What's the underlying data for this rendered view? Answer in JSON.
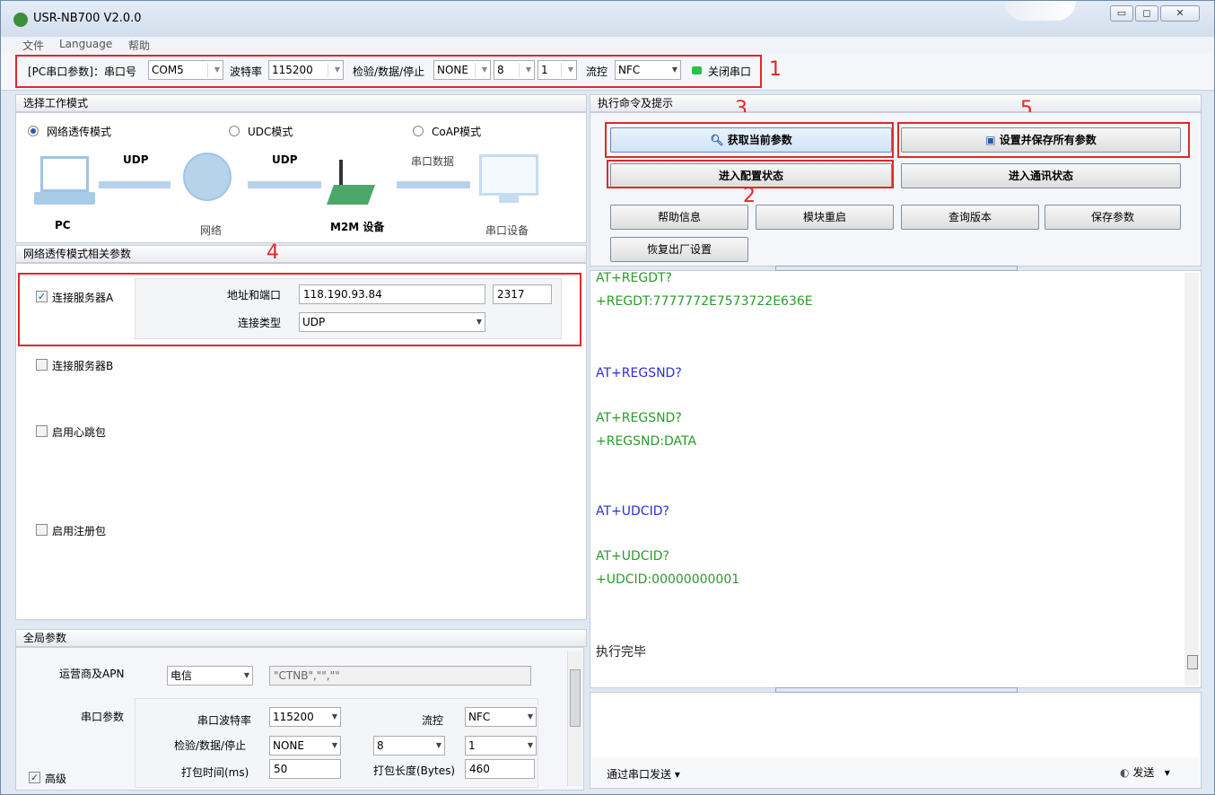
{
  "window": {
    "title": "USR-NB700 V2.0.0",
    "min": "▭",
    "max": "◻",
    "close": "✕"
  },
  "menu": [
    "文件",
    "Language",
    "帮助"
  ],
  "toolbar": {
    "pc_label": "[PC串口参数]：串口号",
    "port": "COM5",
    "baud_label": "波特率",
    "baud": "115200",
    "parity_label": "检验/数据/停止",
    "parity": "NONE",
    "databits": "8",
    "stopbits": "1",
    "flow_label": "流控",
    "flow": "NFC",
    "close_port": "关闭串口",
    "status_color": "#27c24c"
  },
  "annotations": {
    "n1": "1",
    "n2": "2",
    "n3": "3",
    "n4": "4",
    "n5": "5"
  },
  "mode_panel": {
    "header": "选择工作模式",
    "modes": [
      "网络透传模式",
      "UDC模式",
      "CoAP模式"
    ],
    "selected": "网络透传模式",
    "diagram": {
      "pc": "PC",
      "net": "网络",
      "m2m": "M2M 设备",
      "serial_dev": "串口设备",
      "udp1": "UDP",
      "udp2": "UDP",
      "serial_data": "串口数据"
    }
  },
  "net_params": {
    "header": "网络透传模式相关参数",
    "server_a": {
      "label": "连接服务器A",
      "checked": true,
      "addr_label": "地址和端口",
      "addr": "118.190.93.84",
      "port": "2317",
      "type_label": "连接类型",
      "type": "UDP"
    },
    "server_b": {
      "label": "连接服务器B",
      "checked": false
    },
    "heartbeat": {
      "label": "启用心跳包",
      "checked": false
    },
    "register": {
      "label": "启用注册包",
      "checked": false
    }
  },
  "global": {
    "header": "全局参数",
    "apn_label": "运营商及APN",
    "carrier": "电信",
    "apn": "\"CTNB\",\"\",\"\"",
    "serial_label": "串口参数",
    "baud_label": "串口波特率",
    "baud": "115200",
    "flow_label": "流控",
    "flow": "NFC",
    "parity_label": "检验/数据/停止",
    "parity": "NONE",
    "databits": "8",
    "stopbits": "1",
    "pack_time_label": "打包时间(ms)",
    "pack_time": "50",
    "pack_len_label": "打包长度(Bytes)",
    "pack_len": "460",
    "advanced": "高级"
  },
  "cmd_panel": {
    "header": "执行命令及提示",
    "get_params": "获取当前参数",
    "save_all": "设置并保存所有参数",
    "enter_config": "进入配置状态",
    "enter_comm": "进入通讯状态",
    "help": "帮助信息",
    "restart": "模块重启",
    "query_ver": "查询版本",
    "save_params": "保存参数",
    "factory": "恢复出厂设置"
  },
  "log": [
    {
      "text": "AT+REGDT?",
      "color": "green"
    },
    {
      "text": "+REGDT:7777772E7573722E636E",
      "color": "green"
    },
    {
      "text": "AT+REGSND?",
      "color": "blue"
    },
    {
      "text": "AT+REGSND?",
      "color": "green"
    },
    {
      "text": "+REGSND:DATA",
      "color": "green"
    },
    {
      "text": "AT+UDCID?",
      "color": "blue"
    },
    {
      "text": "AT+UDCID?",
      "color": "green"
    },
    {
      "text": "+UDCID:00000000001",
      "color": "green"
    },
    {
      "text": "执行完毕",
      "color": "black"
    }
  ],
  "send": {
    "via": "通过串口发送",
    "send_label": "发送"
  }
}
